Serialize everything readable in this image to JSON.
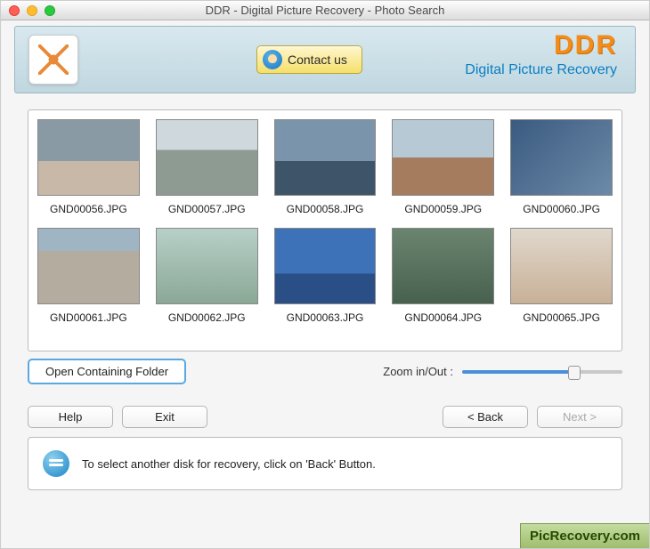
{
  "window": {
    "title": "DDR - Digital Picture Recovery - Photo Search"
  },
  "banner": {
    "contact_label": "Contact us",
    "brand_logo": "DDR",
    "brand_sub": "Digital Picture Recovery"
  },
  "gallery": {
    "thumbs": [
      {
        "filename": "GND00056.JPG"
      },
      {
        "filename": "GND00057.JPG"
      },
      {
        "filename": "GND00058.JPG"
      },
      {
        "filename": "GND00059.JPG"
      },
      {
        "filename": "GND00060.JPG"
      },
      {
        "filename": "GND00061.JPG"
      },
      {
        "filename": "GND00062.JPG"
      },
      {
        "filename": "GND00063.JPG"
      },
      {
        "filename": "GND00064.JPG"
      },
      {
        "filename": "GND00065.JPG"
      }
    ]
  },
  "controls": {
    "open_folder": "Open Containing Folder",
    "zoom_label": "Zoom in/Out :",
    "zoom_value_pct": 70
  },
  "nav": {
    "help": "Help",
    "exit": "Exit",
    "back": "< Back",
    "next": "Next >"
  },
  "info": {
    "text": "To select another disk for recovery, click on 'Back' Button."
  },
  "watermark": {
    "text": "PicRecovery.com"
  }
}
